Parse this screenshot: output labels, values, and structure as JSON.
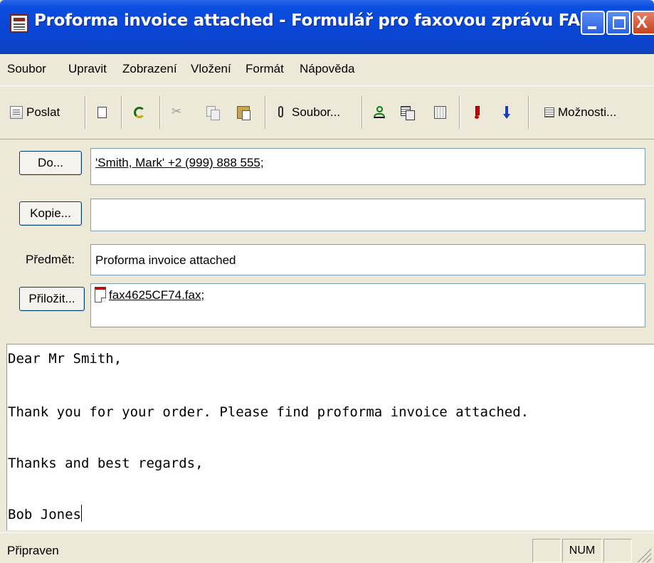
{
  "window": {
    "title": "Proforma invoice attached - Formulář pro faxovou zprávu FAXmaker <b...",
    "controls": {
      "minimize": "_",
      "maximize": "□",
      "close": "X"
    }
  },
  "menu": [
    "Soubor",
    "Upravit",
    "Zobrazení",
    "Vložení",
    "Formát",
    "Nápověda"
  ],
  "toolbar": {
    "send_label": "Poslat",
    "attach_label": "Soubor...",
    "options_label": "Možnosti...",
    "icons": [
      "send-icon",
      "new-doc-icon",
      "undo-icon",
      "cut-icon",
      "copy-icon",
      "paste-icon",
      "paperclip-icon",
      "address-book-icon",
      "check-names-icon",
      "book-icon",
      "high-priority-icon",
      "low-priority-icon",
      "options-icon"
    ]
  },
  "header": {
    "to_button": "Do...",
    "to_value": "'Smith, Mark' +2 (999) 888 555;",
    "cc_button": "Kopie...",
    "cc_value": "",
    "subject_label": "Předmět:",
    "subject_value": "Proforma invoice attached",
    "attach_button": "Přiložit...",
    "attach_value": "fax4625CF74.fax;"
  },
  "body": {
    "lines": [
      "Dear Mr Smith,",
      "Thank you for your order. Please find proforma invoice attached.",
      "Thanks and best regards,",
      "Bob Jones"
    ]
  },
  "status": {
    "text": "Připraven",
    "num": "NUM"
  }
}
